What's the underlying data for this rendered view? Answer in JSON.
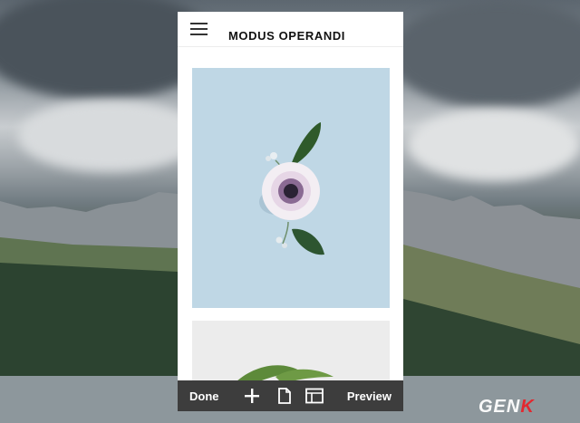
{
  "header": {
    "title": "MODUS OPERANDI"
  },
  "toolbar": {
    "done_label": "Done",
    "preview_label": "Preview",
    "icons": [
      "plus-icon",
      "page-icon",
      "layout-icon"
    ]
  },
  "watermark": {
    "main": "GEN",
    "accent": "K"
  },
  "colors": {
    "toolbar_bg": "#3d3d3d",
    "photo_bg": "#bfd7e5",
    "accent": "#e8232a"
  }
}
